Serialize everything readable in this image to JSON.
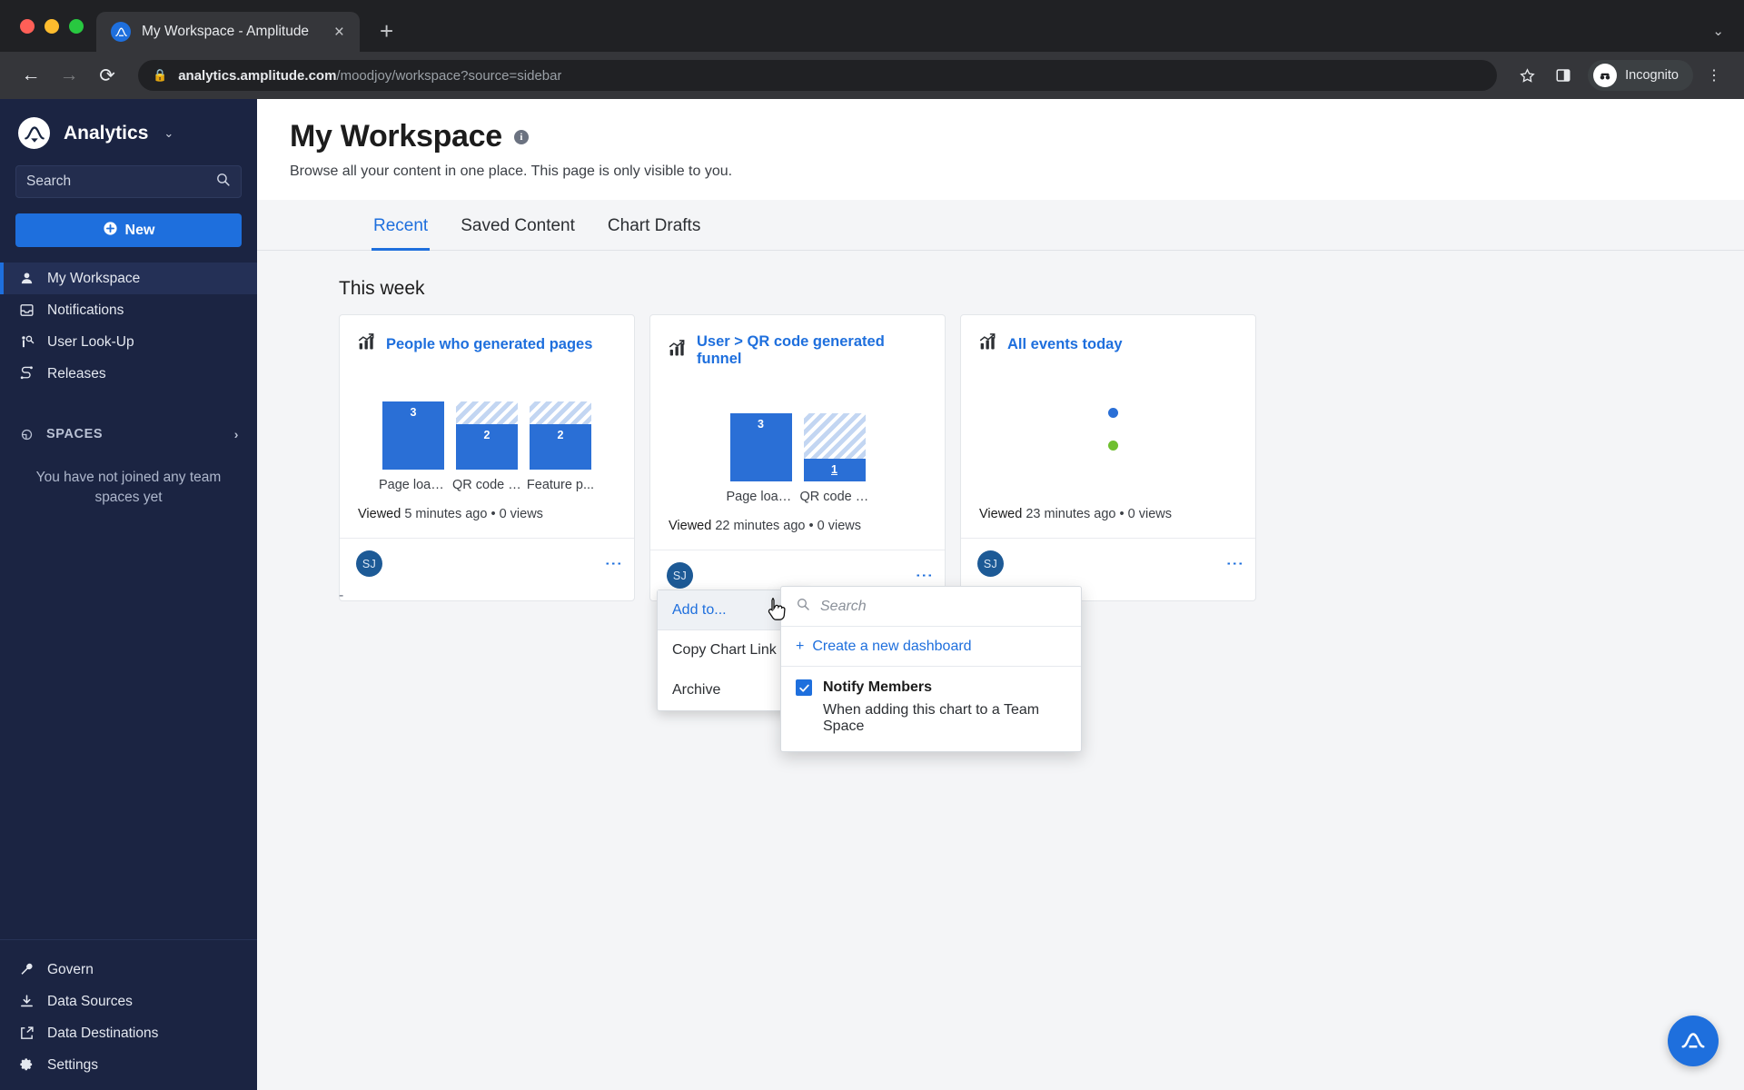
{
  "browser": {
    "tab": {
      "title": "My Workspace - Amplitude",
      "close_label": "×",
      "favicon": "amplitude-icon"
    },
    "new_tab_label": "+",
    "tabstrip_menu": "⌄",
    "back_label": "←",
    "forward_label": "→",
    "reload_label": "⟳",
    "url_host": "analytics.amplitude.com",
    "url_path": "/moodjoy/workspace?source=sidebar",
    "bookmark_icon": "star-icon",
    "sidepanel_icon": "side-panel-icon",
    "profile_label": "Incognito",
    "menu_label": "⋮"
  },
  "sidebar": {
    "brand": "Analytics",
    "brand_chevron": "⌄",
    "search_placeholder": "Search",
    "new_button": "New",
    "nav_items": [
      {
        "label": "My Workspace",
        "icon": "person-icon",
        "active": true
      },
      {
        "label": "Notifications",
        "icon": "inbox-icon",
        "active": false
      },
      {
        "label": "User Look-Up",
        "icon": "user-search-icon",
        "active": false
      },
      {
        "label": "Releases",
        "icon": "releases-icon",
        "active": false
      }
    ],
    "spaces_label": "SPACES",
    "spaces_empty": "You have not joined any team spaces yet",
    "bottom_items": [
      {
        "label": "Govern",
        "icon": "wrench-icon"
      },
      {
        "label": "Data Sources",
        "icon": "download-icon"
      },
      {
        "label": "Data Destinations",
        "icon": "upload-share-icon"
      },
      {
        "label": "Settings",
        "icon": "gear-icon"
      }
    ]
  },
  "header": {
    "title": "My Workspace",
    "info_glyph": "i",
    "subtitle": "Browse all your content in one place. This page is only visible to you."
  },
  "tabs": [
    {
      "label": "Recent",
      "active": true
    },
    {
      "label": "Saved Content",
      "active": false
    },
    {
      "label": "Chart Drafts",
      "active": false
    }
  ],
  "section": {
    "title": "This week",
    "stray_text": "-"
  },
  "cards": [
    {
      "title": "People who generated pages",
      "icon": "chart-icon",
      "viewed_label": "Viewed",
      "viewed_time": "5 minutes ago",
      "separator": "•",
      "views": "0 views",
      "avatar": "SJ",
      "kebab": "⋮",
      "chart_ref": 0
    },
    {
      "title": "User > QR code generated funnel",
      "icon": "chart-icon",
      "viewed_label": "Viewed",
      "viewed_time": "22 minutes ago",
      "separator": "•",
      "views": "0 views",
      "avatar": "SJ",
      "kebab": "⋮",
      "chart_ref": 1
    },
    {
      "title": "All events today",
      "icon": "chart-icon",
      "viewed_label": "Viewed",
      "viewed_time": "23 minutes ago",
      "separator": "•",
      "views": "0 views",
      "avatar": "SJ",
      "kebab": "⋮",
      "chart_ref": 2
    }
  ],
  "context_menu": {
    "items": [
      {
        "label": "Add to...",
        "active": true
      },
      {
        "label": "Copy Chart Link",
        "active": false
      },
      {
        "label": "Archive",
        "active": false
      }
    ]
  },
  "popover": {
    "search_placeholder": "Search",
    "search_icon": "search-icon",
    "create_label": "Create a new dashboard",
    "create_plus": "+",
    "notify_title": "Notify Members",
    "notify_sub": "When adding this chart to a Team Space",
    "notify_checked": true
  },
  "fab": {
    "icon": "amplitude-icon"
  },
  "colors": {
    "accent": "#1e6fdd",
    "bar_solid": "#2a6fd6",
    "bar_ghost": "#c3d6f2",
    "sidebar_bg": "#1b2442",
    "dot_blue": "#2a6fd6",
    "dot_green": "#6fbf2f"
  },
  "chart_data": [
    {
      "type": "bar",
      "title": "People who generated pages",
      "categories": [
        "Page load...",
        "QR code g...",
        "Feature p..."
      ],
      "values": [
        3,
        2,
        2
      ],
      "ghost_values": [
        0,
        1,
        1
      ],
      "max": 3,
      "xlabel": "",
      "ylabel": "",
      "ylim": [
        0,
        3
      ],
      "grid": false,
      "legend": false,
      "data_labels": [
        "3",
        "2",
        "2"
      ]
    },
    {
      "type": "bar",
      "title": "User > QR code generated funnel",
      "categories": [
        "Page loaded",
        "QR code generat..."
      ],
      "values": [
        3,
        1
      ],
      "ghost_values": [
        0,
        2
      ],
      "max": 3,
      "xlabel": "",
      "ylabel": "",
      "ylim": [
        0,
        3
      ],
      "grid": false,
      "legend": false,
      "data_labels": [
        "3",
        "1"
      ]
    },
    {
      "type": "scatter",
      "title": "All events today",
      "points": [
        {
          "x": 0.5,
          "y": 0.62,
          "color": "#2a6fd6"
        },
        {
          "x": 0.5,
          "y": 0.38,
          "color": "#6fbf2f"
        }
      ],
      "xlabel": "",
      "ylabel": "",
      "grid": false,
      "legend": false
    }
  ]
}
